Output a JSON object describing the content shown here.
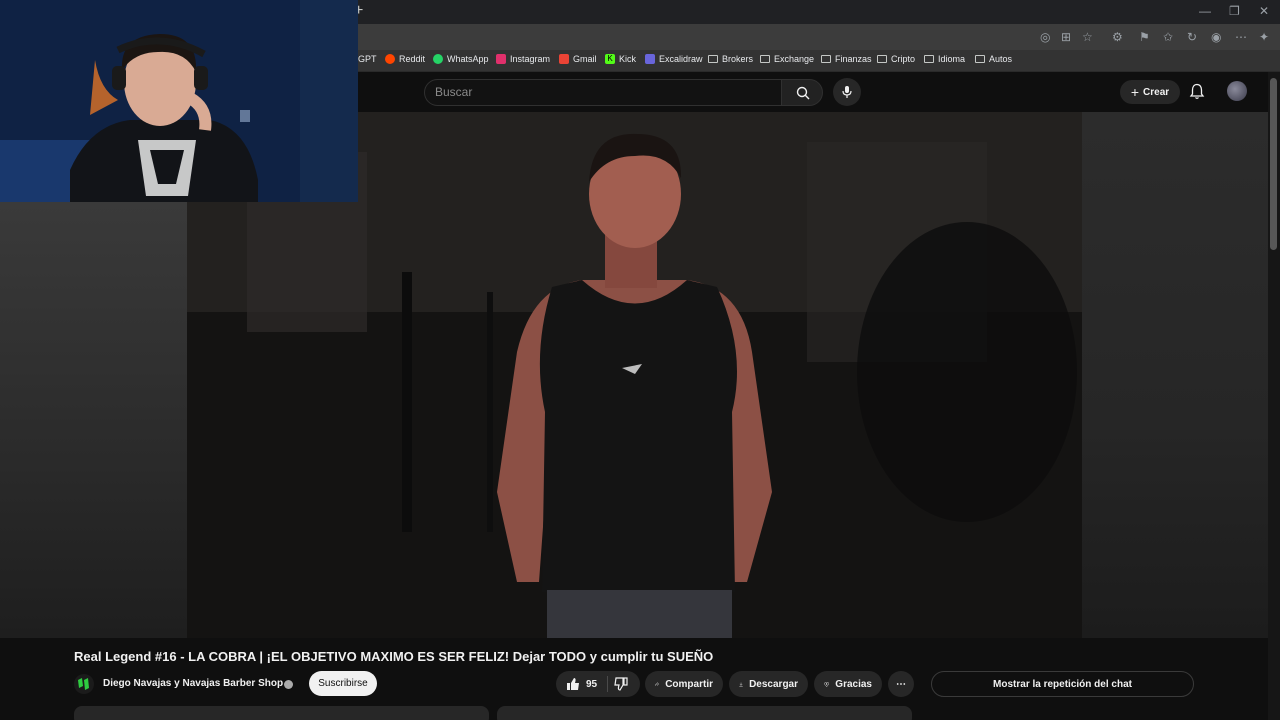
{
  "browser": {
    "new_tab_glyph": "+",
    "bookmarks": [
      {
        "label": "GPT",
        "icon": "chatgpt-icon",
        "color": "#9aa0a6"
      },
      {
        "label": "Reddit",
        "icon": "reddit-icon",
        "color": "#ff4500"
      },
      {
        "label": "WhatsApp",
        "icon": "whatsapp-icon",
        "color": "#25d366"
      },
      {
        "label": "Instagram",
        "icon": "instagram-icon",
        "color": "#e1306c"
      },
      {
        "label": "Gmail",
        "icon": "gmail-icon",
        "color": "#ea4335"
      },
      {
        "label": "Kick",
        "icon": "kick-icon",
        "color": "#53fc18"
      },
      {
        "label": "Excalidraw",
        "icon": "excalidraw-icon",
        "color": "#6965db"
      },
      {
        "label": "Brokers",
        "icon": "folder-icon"
      },
      {
        "label": "Exchange",
        "icon": "folder-icon"
      },
      {
        "label": "Finanzas",
        "icon": "folder-icon"
      },
      {
        "label": "Cripto",
        "icon": "folder-icon"
      },
      {
        "label": "Idioma",
        "icon": "folder-icon"
      },
      {
        "label": "Autos",
        "icon": "folder-icon"
      }
    ]
  },
  "youtube": {
    "search_placeholder": "Buscar",
    "create_label": "Crear",
    "video_title": "Real Legend #16 - LA COBRA | ¡EL OBJETIVO MAXIMO ES SER FELIZ! Dejar TODO y cumplir tu SUEÑO",
    "channel_name": "Diego Navajas y Navajas Barber Shop",
    "subscribe_label": "Suscribirse",
    "like_count": "95",
    "share_label": "Compartir",
    "download_label": "Descargar",
    "thanks_label": "Gracias",
    "more_glyph": "⋯",
    "chat_replay_label": "Mostrar la repetición del chat"
  },
  "colors": {
    "background": "#0f0f0f",
    "pill": "#272727",
    "subscribe_bg": "#f1f1f1",
    "brand_channel": "#2ecc40"
  }
}
